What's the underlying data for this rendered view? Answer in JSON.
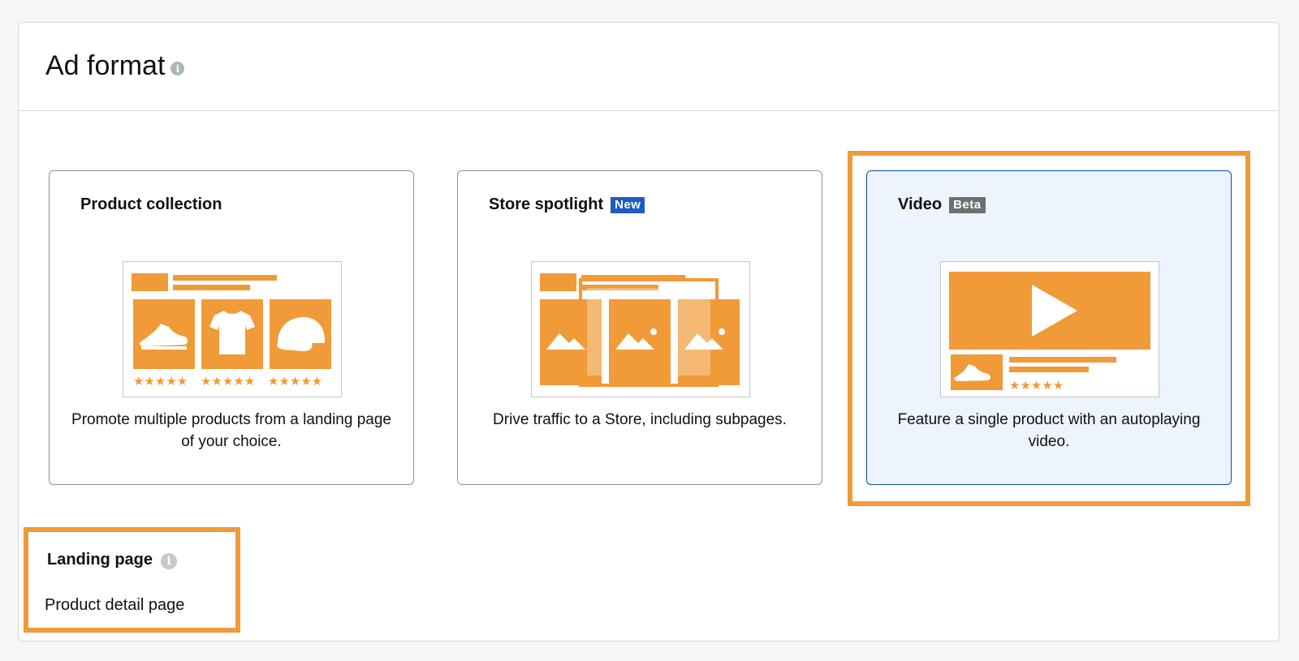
{
  "panel": {
    "title": "Ad format",
    "info_icon": "info-icon"
  },
  "cards": [
    {
      "title": "Product collection",
      "badge": "",
      "description": "Promote multiple products from a landing page of your choice.",
      "selected": false,
      "illustration": "product-collection-illustration"
    },
    {
      "title": "Store spotlight",
      "badge": "New",
      "description": "Drive traffic to a Store, including subpages.",
      "selected": false,
      "illustration": "store-spotlight-illustration"
    },
    {
      "title": "Video",
      "badge": "Beta",
      "description": "Feature a single product with an autoplaying video.",
      "selected": true,
      "illustration": "video-illustration"
    }
  ],
  "landing_page": {
    "label": "Landing page",
    "value": "Product detail page",
    "info_icon": "info-icon"
  },
  "colors": {
    "accent_orange": "#f09a38",
    "illustration_orange": "#f09a38",
    "selected_bg": "#edf4fd",
    "selected_border": "#0a4ea2",
    "badge_new": "#1d5cc7",
    "badge_beta": "#6d6f71"
  }
}
